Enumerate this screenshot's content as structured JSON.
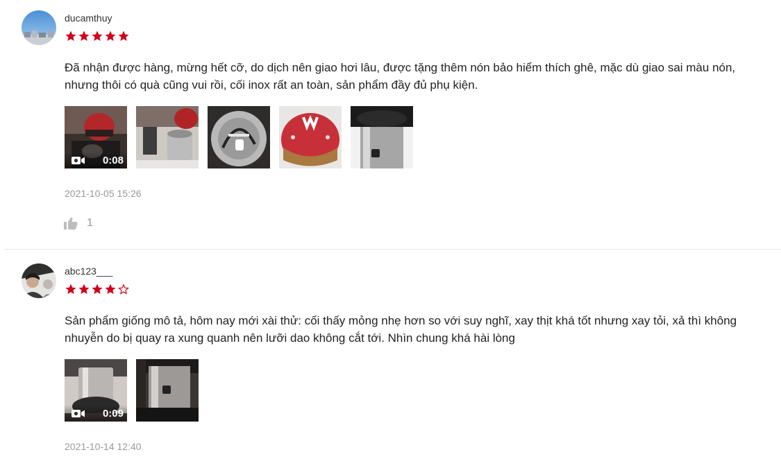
{
  "colors": {
    "star": "#d0011b",
    "meta": "#999999",
    "divider": "#e5e5e5"
  },
  "reviews": [
    {
      "username": "ducamthuy",
      "rating": 5,
      "max_rating": 5,
      "text": "Đã nhận được hàng, mừng hết cỡ, do dịch nên giao hơi lâu, được tặng thêm nón bảo hiểm thích ghê, mặc dù giao sai màu nón, nhưng thôi có quà cũng vui rồi, cối inox rất an toàn, sản phẩm đầy đủ phụ kiện.",
      "video_duration": "0:08",
      "timestamp": "2021-10-05 15:26",
      "likes": "1"
    },
    {
      "username": "abc123___",
      "rating": 4,
      "max_rating": 5,
      "text": "Sản phẩm giống mô tả, hôm nay mới xài thử: cối thấy mỏng nhẹ hơn so với suy nghĩ, xay thịt khá tốt nhưng xay tỏi, xả thì không nhuyễn do bị quay ra xung quanh nên lưỡi dao không cắt tới. Nhìn chung khá hài lòng",
      "video_duration": "0:09",
      "timestamp": "2021-10-14 12:40"
    }
  ]
}
